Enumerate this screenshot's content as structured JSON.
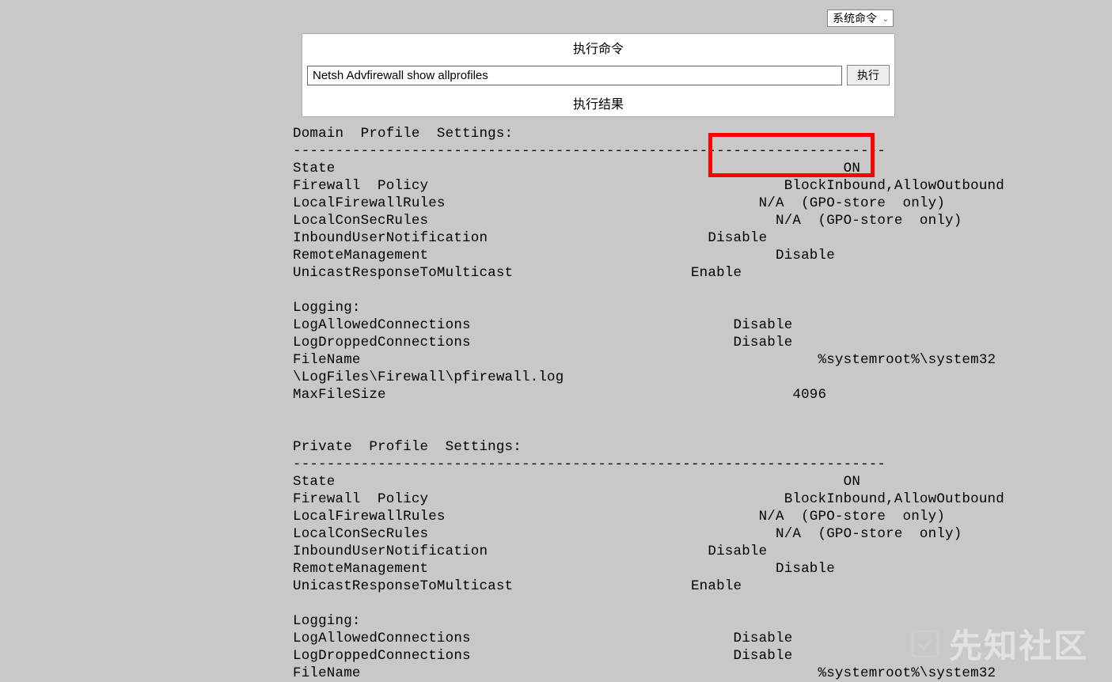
{
  "dropdown": {
    "selected": "系统命令"
  },
  "panel": {
    "exec_header": "执行命令",
    "command_value": "Netsh Advfirewall show allprofiles",
    "run_label": "执行",
    "result_header": "执行结果"
  },
  "output_text": "Domain  Profile  Settings: \n----------------------------------------------------------------------\nState                                                            ON\nFirewall  Policy                                          BlockInbound,AllowOutbound\nLocalFirewallRules                                     N/A  (GPO-store  only)\nLocalConSecRules                                         N/A  (GPO-store  only)\nInboundUserNotification                          Disable\nRemoteManagement                                         Disable\nUnicastResponseToMulticast                     Enable\n\nLogging:\nLogAllowedConnections                               Disable\nLogDroppedConnections                               Disable\nFileName                                                      %systemroot%\\system32\n\\LogFiles\\Firewall\\pfirewall.log\nMaxFileSize                                                4096\n\n\nPrivate  Profile  Settings: \n----------------------------------------------------------------------\nState                                                            ON\nFirewall  Policy                                          BlockInbound,AllowOutbound\nLocalFirewallRules                                     N/A  (GPO-store  only)\nLocalConSecRules                                         N/A  (GPO-store  only)\nInboundUserNotification                          Disable\nRemoteManagement                                         Disable\nUnicastResponseToMulticast                     Enable\n\nLogging:\nLogAllowedConnections                               Disable\nLogDroppedConnections                               Disable\nFileName                                                      %systemroot%\\system32",
  "watermark": "先知社区"
}
